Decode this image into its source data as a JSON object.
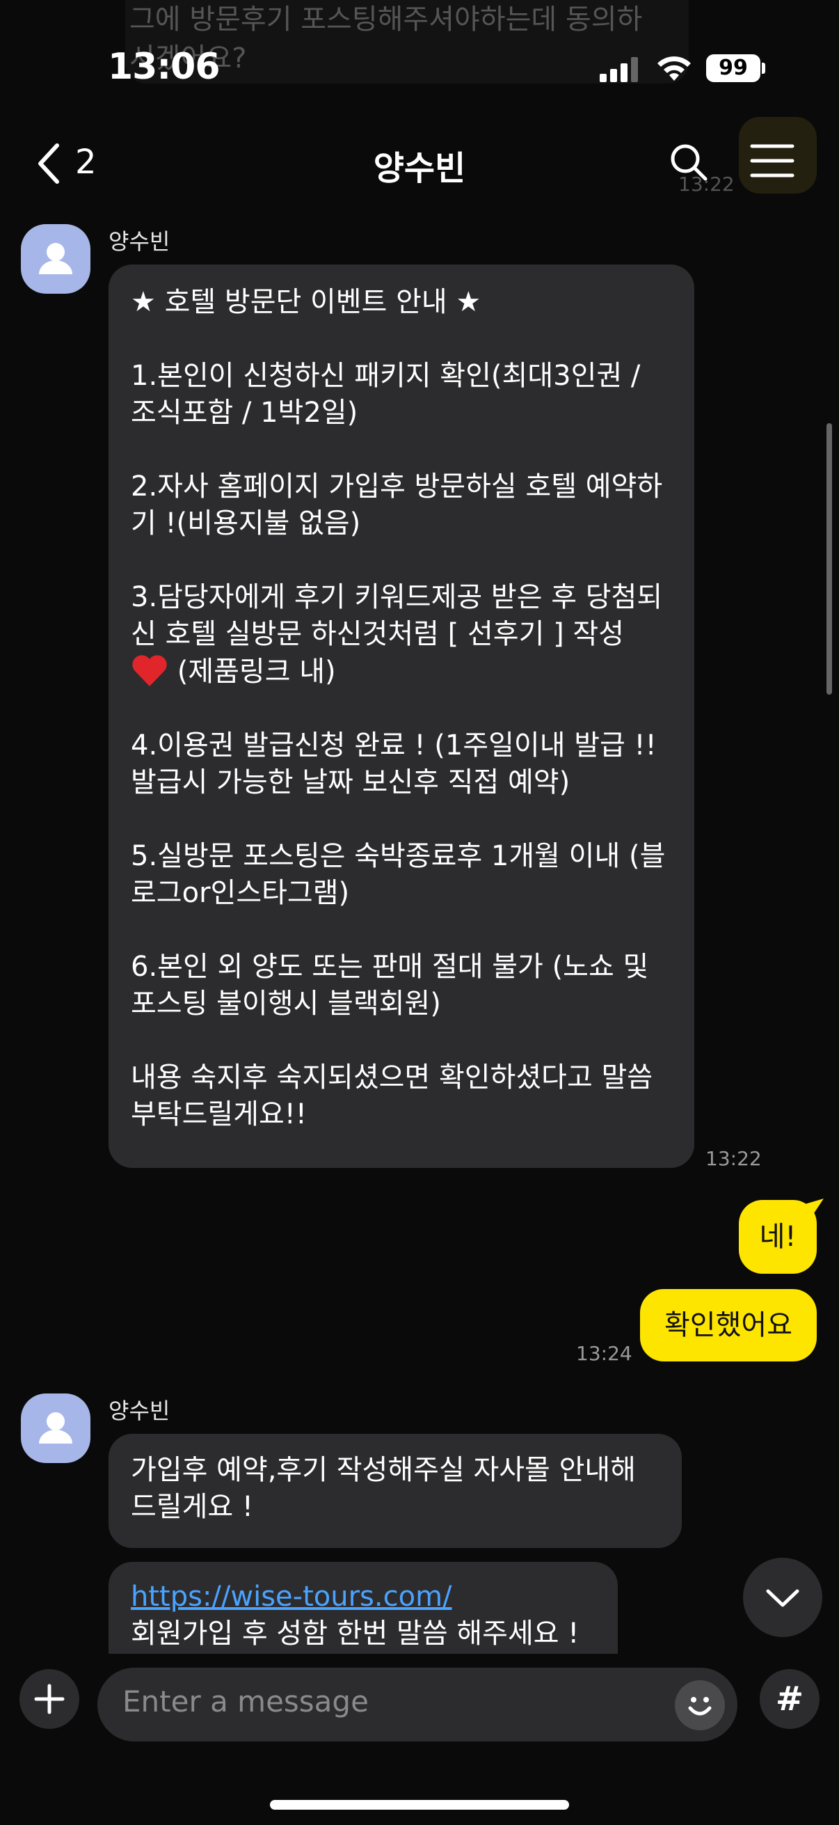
{
  "status_bar": {
    "time": "13:06",
    "battery": "99"
  },
  "header": {
    "back_count": "2",
    "title": "양수빈"
  },
  "background_text": "그에 방문후기 포스팅해주셔야하는데 동의하\n시겠어요?",
  "header_ghost_time": "13:22",
  "messages": [
    {
      "sender": "양수빈",
      "text": "★ 호텔 방문단 이벤트 안내 ★\n\n1.본인이 신청하신 패키지 확인(최대3인권 / 조식포함 / 1박2일)\n\n2.자사 홈페이지 가입후 방문하실 호텔 예약하기 !(비용지불 없음)\n\n3.담당자에게 후기 키워드제공 받은 후 당첨되신 호텔 실방문 하신것처럼 [ 선후기 ] 작성",
      "text_after_heart": " (제품링크 내)",
      "text_rest": "4.이용권 발급신청 완료 ! (1주일이내 발급 !! 발급시 가능한 날짜 보신후 직접 예약)\n\n5.실방문 포스팅은 숙박종료후 1개월 이내 (블로그or인스타그램)\n\n6.본인 외 양도 또는 판매 절대 불가 (노쇼 및 포스팅 불이행시 블랙회원)\n\n내용 숙지후 숙지되셨으면 확인하셨다고 말씀 부탁드릴게요!!",
      "time": "13:22"
    },
    {
      "outgoing": true,
      "text": "네!"
    },
    {
      "outgoing": true,
      "text": "확인했어요",
      "time": "13:24"
    },
    {
      "sender": "양수빈",
      "text": "가입후 예약,후기 작성해주실 자사몰 안내해드릴게요 !"
    },
    {
      "link": "https://wise-tours.com/",
      "text": "회원가입 후 성함 한번 말씀 해주세요 !"
    }
  ],
  "input": {
    "placeholder": "Enter a message"
  },
  "colors": {
    "accent": "#fee500",
    "bubble_in": "#2c2c2e",
    "avatar": "#a7b6e8",
    "link": "#4aa3ff"
  }
}
